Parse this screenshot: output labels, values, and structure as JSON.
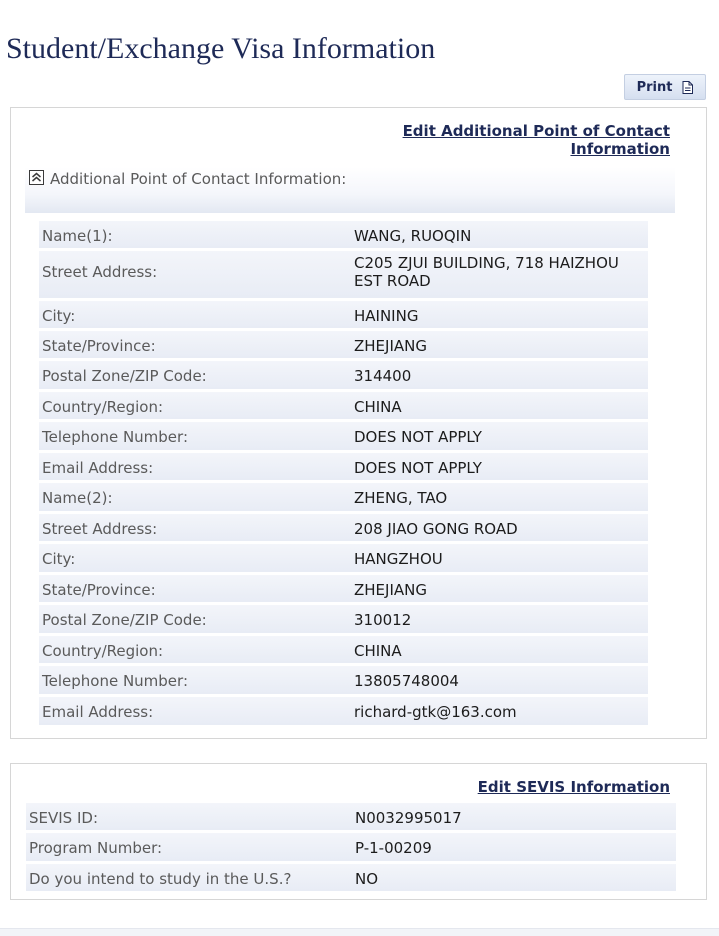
{
  "page": {
    "title": "Student/Exchange Visa Information",
    "print_label": "Print"
  },
  "icons": {
    "print": "document-icon",
    "collapse": "double-chevron-up-icon"
  },
  "colors": {
    "title": "#1e2a57",
    "row_background": "#e8ecf5",
    "label_text": "#5a5a5a"
  },
  "contact": {
    "edit_link": "Edit Additional Point of Contact Information",
    "section_label": "Additional Point of Contact Information:",
    "rows": [
      {
        "label": "Name(1):",
        "value": "WANG, RUOQIN"
      },
      {
        "label": "Street Address:",
        "value": "C205 ZJUI BUILDING, 718 HAIZHOU EST ROAD"
      },
      {
        "label": "City:",
        "value": "HAINING"
      },
      {
        "label": "State/Province:",
        "value": "ZHEJIANG"
      },
      {
        "label": "Postal Zone/ZIP Code:",
        "value": "314400"
      },
      {
        "label": "Country/Region:",
        "value": "CHINA"
      },
      {
        "label": "Telephone Number:",
        "value": "DOES NOT APPLY"
      },
      {
        "label": "Email Address:",
        "value": "DOES NOT APPLY"
      },
      {
        "label": "Name(2):",
        "value": "ZHENG, TAO"
      },
      {
        "label": "Street Address:",
        "value": "208 JIAO GONG ROAD"
      },
      {
        "label": "City:",
        "value": "HANGZHOU"
      },
      {
        "label": "State/Province:",
        "value": "ZHEJIANG"
      },
      {
        "label": "Postal Zone/ZIP Code:",
        "value": "310012"
      },
      {
        "label": "Country/Region:",
        "value": "CHINA"
      },
      {
        "label": "Telephone Number:",
        "value": "13805748004"
      },
      {
        "label": "Email Address:",
        "value": "richard-gtk@163.com"
      }
    ]
  },
  "sevis": {
    "edit_link": "Edit SEVIS Information",
    "rows": [
      {
        "label": "SEVIS ID:",
        "value": "N0032995017"
      },
      {
        "label": "Program Number:",
        "value": "P-1-00209"
      },
      {
        "label": "Do you intend to study in the U.S.?",
        "value": "NO"
      }
    ]
  }
}
